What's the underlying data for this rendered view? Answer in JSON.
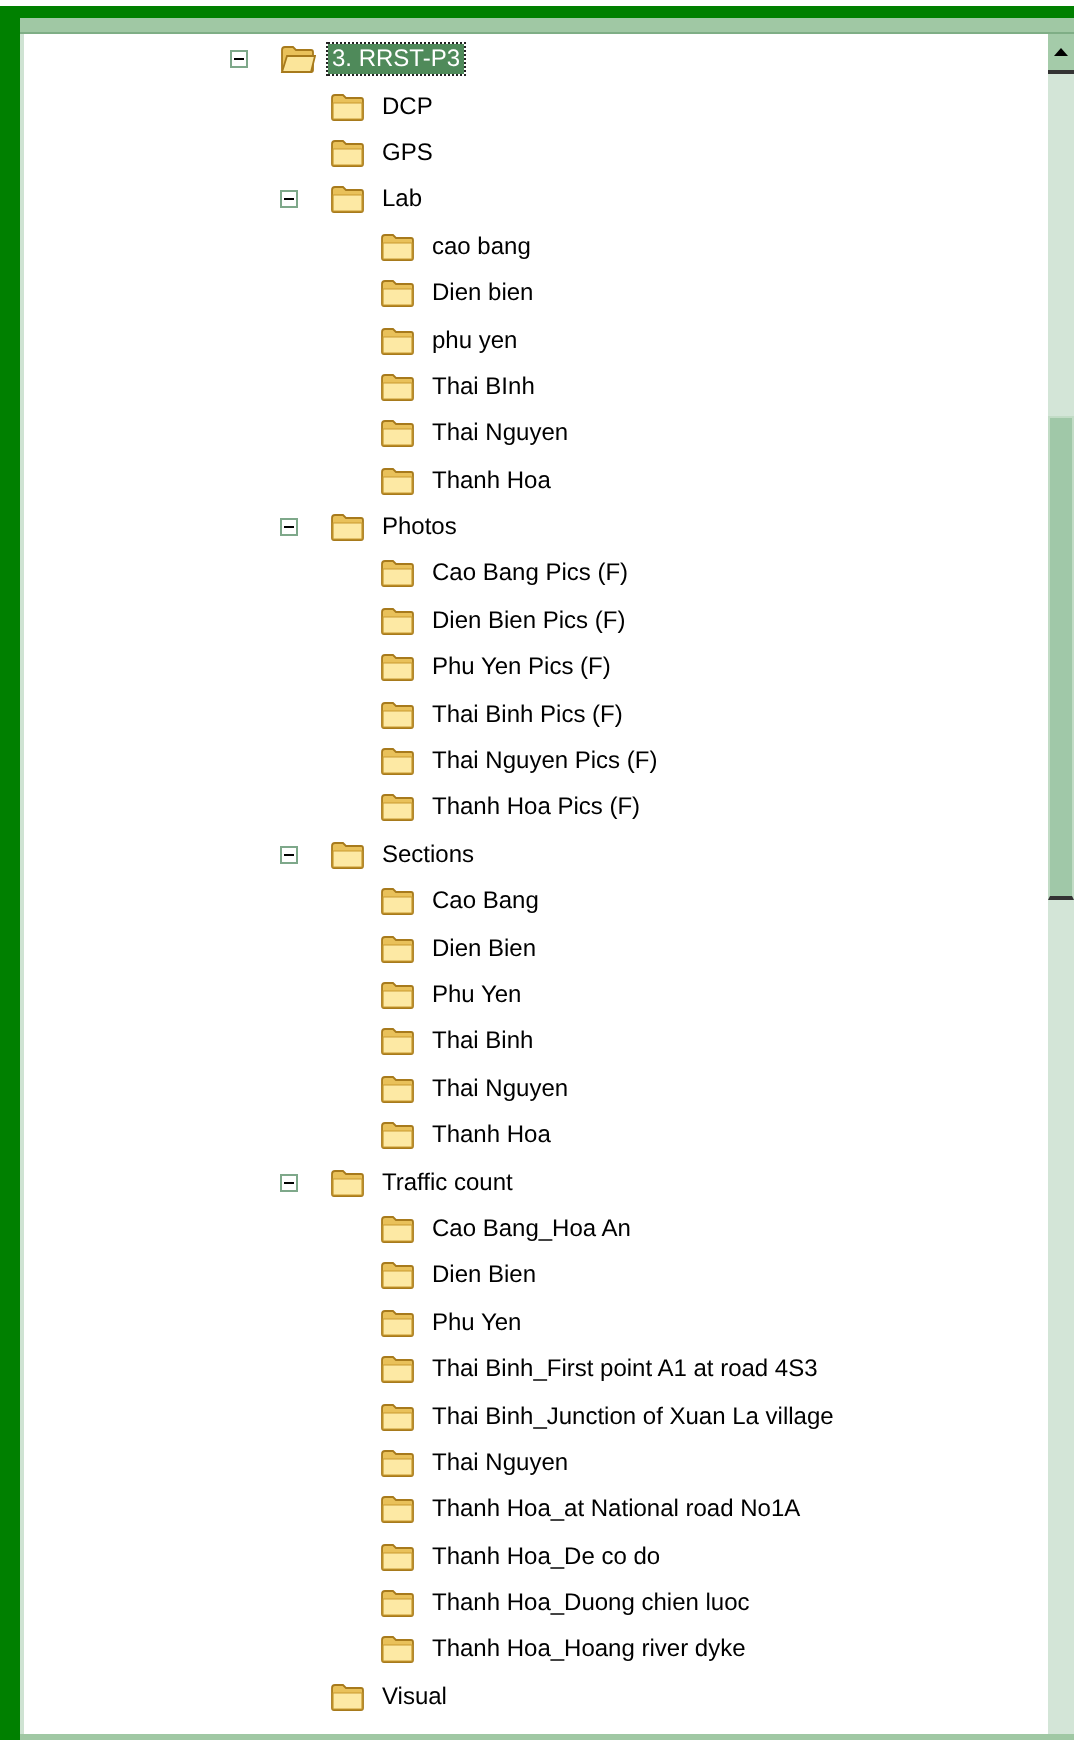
{
  "tree": [
    {
      "label": "3. RRST-P3",
      "selected": true,
      "expanded": true,
      "children": [
        {
          "label": "DCP",
          "selected": false
        },
        {
          "label": "GPS",
          "selected": false
        },
        {
          "label": "Lab",
          "selected": false,
          "expanded": true,
          "children": [
            {
              "label": "cao bang",
              "selected": false
            },
            {
              "label": "Dien bien",
              "selected": false
            },
            {
              "label": "phu yen",
              "selected": false
            },
            {
              "label": "Thai BInh",
              "selected": false
            },
            {
              "label": "Thai Nguyen",
              "selected": false
            },
            {
              "label": "Thanh Hoa",
              "selected": false
            }
          ]
        },
        {
          "label": "Photos",
          "selected": false,
          "expanded": true,
          "children": [
            {
              "label": "Cao Bang Pics (F)",
              "selected": false
            },
            {
              "label": "Dien Bien Pics (F)",
              "selected": false
            },
            {
              "label": "Phu Yen Pics (F)",
              "selected": false
            },
            {
              "label": "Thai Binh Pics (F)",
              "selected": false
            },
            {
              "label": "Thai Nguyen Pics (F)",
              "selected": false
            },
            {
              "label": "Thanh Hoa Pics (F)",
              "selected": false
            }
          ]
        },
        {
          "label": "Sections",
          "selected": false,
          "expanded": true,
          "children": [
            {
              "label": "Cao Bang",
              "selected": false
            },
            {
              "label": "Dien Bien",
              "selected": false
            },
            {
              "label": "Phu Yen",
              "selected": false
            },
            {
              "label": "Thai Binh",
              "selected": false
            },
            {
              "label": "Thai Nguyen",
              "selected": false
            },
            {
              "label": "Thanh Hoa",
              "selected": false
            }
          ]
        },
        {
          "label": "Traffic count",
          "selected": false,
          "expanded": true,
          "children": [
            {
              "label": "Cao Bang_Hoa An",
              "selected": false
            },
            {
              "label": "Dien Bien",
              "selected": false
            },
            {
              "label": "Phu Yen",
              "selected": false
            },
            {
              "label": "Thai Binh_First point A1 at road 4S3",
              "selected": false
            },
            {
              "label": "Thai Binh_Junction of Xuan La village",
              "selected": false
            },
            {
              "label": "Thai Nguyen",
              "selected": false
            },
            {
              "label": "Thanh Hoa_at National road No1A",
              "selected": false
            },
            {
              "label": "Thanh Hoa_De co do",
              "selected": false
            },
            {
              "label": "Thanh Hoa_Duong chien luoc",
              "selected": false
            },
            {
              "label": "Thanh Hoa_Hoang river dyke",
              "selected": false
            }
          ]
        },
        {
          "label": "Visual",
          "selected": false
        }
      ]
    }
  ]
}
